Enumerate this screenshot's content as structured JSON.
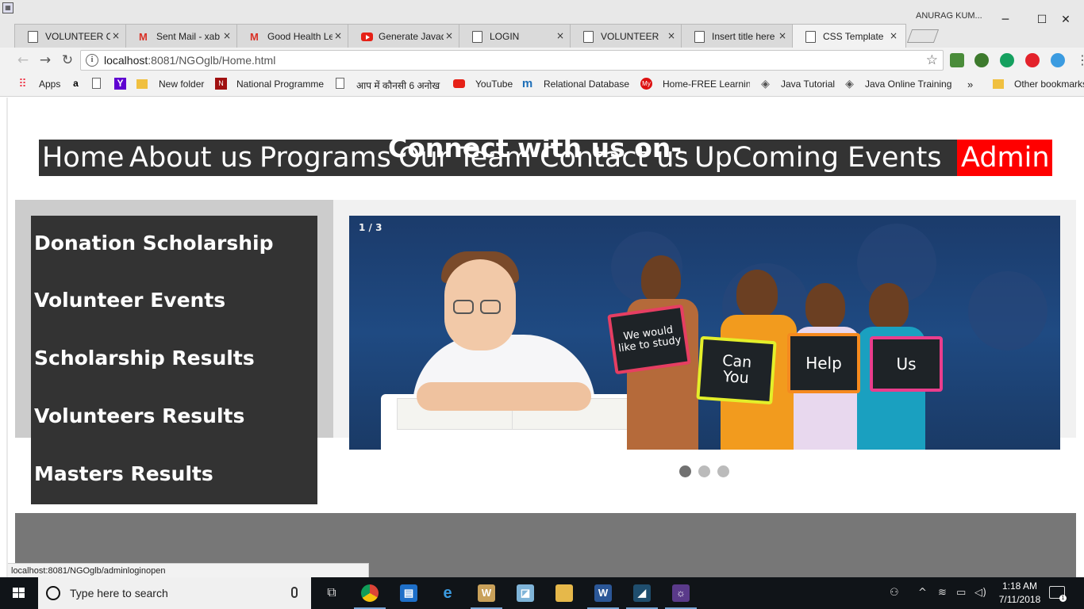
{
  "browser": {
    "user_name": "ANURAG KUM...",
    "tabs": [
      {
        "label": "VOLUNTEER CR",
        "icon": "page-icon"
      },
      {
        "label": "Sent Mail - xab",
        "icon": "gmail-icon"
      },
      {
        "label": "Good Health Le",
        "icon": "gmail-icon"
      },
      {
        "label": "Generate Javad",
        "icon": "youtube-icon"
      },
      {
        "label": "LOGIN",
        "icon": "page-icon"
      },
      {
        "label": "VOLUNTEER",
        "icon": "page-icon"
      },
      {
        "label": "Insert title here",
        "icon": "page-icon"
      },
      {
        "label": "CSS Template",
        "icon": "page-icon"
      }
    ],
    "tab_close_glyph": "×",
    "url_host": "localhost",
    "url_path": ":8081/NGOglb/Home.html",
    "bookmarks": [
      {
        "label": "Apps"
      },
      {
        "label": "New folder"
      },
      {
        "label": "National Programme"
      },
      {
        "label": "आप में कौनसी 6 अनोख"
      },
      {
        "label": "YouTube"
      },
      {
        "label": "Relational Database"
      },
      {
        "label": "Home-FREE Learning"
      },
      {
        "label": "Java Tutorial"
      },
      {
        "label": "Java Online Training"
      },
      {
        "label": "»"
      },
      {
        "label": "Other bookmarks"
      }
    ],
    "status_url": "localhost:8081/NGOglb/adminloginopen"
  },
  "site": {
    "nav": {
      "home": "Home",
      "about": "About us",
      "programs": "Programs",
      "team": "Our Team",
      "contact": "Contact us",
      "events": "UpComing Events",
      "admin": "Admin"
    },
    "side_menu": [
      "Donation Scholarship",
      "Volunteer Events",
      "Scholarship Results",
      "Volunteers Results",
      "Masters Results"
    ],
    "slideshow": {
      "counter": "1 / 3",
      "boards": {
        "board1": "We would like to study",
        "board2_line1": "Can",
        "board2_line2": "You",
        "board3": "Help",
        "board4": "Us"
      },
      "dots_total": 3,
      "active_dot": 1
    },
    "footer_title": "Connect with us on-",
    "colors": {
      "navbar": "#333333",
      "admin": "#ff0000",
      "side_menu": "#333333",
      "footer": "#777777"
    }
  },
  "taskbar": {
    "search_placeholder": "Type here to search",
    "time": "1:18 AM",
    "date": "7/11/2018",
    "notification_count": "1"
  }
}
